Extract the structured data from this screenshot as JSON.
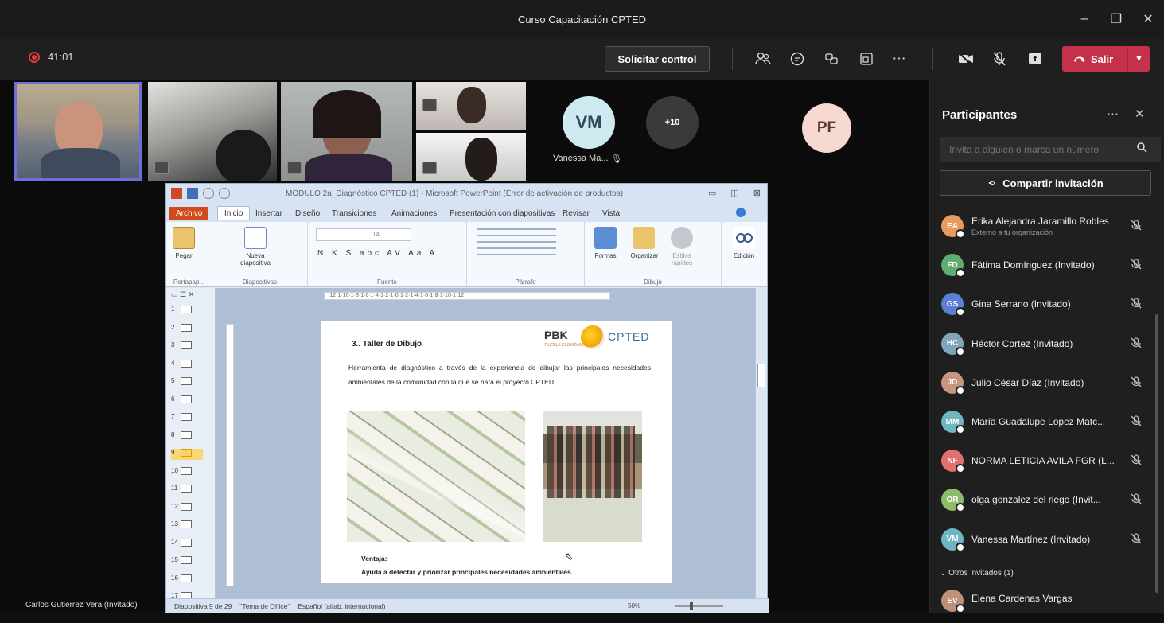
{
  "window": {
    "title": "Curso Capacitación CPTED",
    "minimize": "–",
    "maximize": "❐",
    "close": "✕"
  },
  "callbar": {
    "timer": "41:01",
    "request_control": "Solicitar control",
    "leave_label": "Salir",
    "icons": [
      "participants-icon",
      "chat-icon",
      "reactions-icon",
      "rooms-icon",
      "more-icon",
      "camera-off-icon",
      "mic-off-icon",
      "share-icon"
    ]
  },
  "stage": {
    "tiles": [
      {
        "initials": "VM",
        "name": "Vanessa Ma...",
        "color": "#cfe9f0"
      },
      {
        "initials": "+10",
        "color": "#3a3a3a"
      },
      {
        "initials": "PF",
        "color": "#f6d9d0"
      }
    ],
    "presenter_name": "Carlos Gutierrez Vera (Invitado)"
  },
  "ppt": {
    "doc_title": "MÓDULO 2a_Diagnóstico CPTED (1) - Microsoft PowerPoint (Error de activación de productos)",
    "tabs": [
      "Archivo",
      "Inicio",
      "Insertar",
      "Diseño",
      "Transiciones",
      "Animaciones",
      "Presentación con diapositivas",
      "Revisar",
      "Vista"
    ],
    "groups": {
      "clipboard": "Portapap...",
      "paste": "Pegar",
      "slides": "Diapositivas",
      "new_slide": "Nueva diapositiva",
      "font": "Fuente",
      "font_size": "14",
      "format_row": "N K S abc AV Aa A",
      "paragraph": "Párrafo",
      "drawing": "Dibujo",
      "shapes": "Formas",
      "arrange": "Organizar",
      "quick_styles": "Estilos rápidos",
      "editing": "Edición"
    },
    "ruler": "·12·1·10·1·8·1·6·1·4·1·2·1·0·1·2·1·4·1·6·1·8·1·10·1·12",
    "slide_numbers": [
      "1",
      "2",
      "3",
      "4",
      "5",
      "6",
      "7",
      "8",
      "9",
      "10",
      "11",
      "12",
      "13",
      "14",
      "15",
      "16",
      "17"
    ],
    "slide": {
      "title": "3.. Taller de Dibujo",
      "body": "Herramienta de diagnóstico a través de la experiencia de dibujar las principales necesidades ambientales de la comunidad con la que se hará el proyecto CPTED.",
      "logo_pbk": "PBK",
      "logo_pbk_sub": "PUEBLA CIUDADANA",
      "logo_cpted": "CPTED",
      "ventaja_label": "Ventaja:",
      "ventaja_text": "Ayuda a detectar y priorizar principales necesidades ambientales."
    },
    "status": {
      "slide_info": "Diapositiva 9 de 29",
      "theme": "\"Tema de Office\"",
      "language": "Español (alfab. internacional)",
      "zoom": "50%"
    }
  },
  "panel": {
    "title": "Participantes",
    "invite_placeholder": "Invita a alguien o marca un número",
    "share_label": "Compartir invitación",
    "participants": [
      {
        "initials": "EA",
        "name": "Erika Alejandra Jaramillo Robles",
        "sub": "Externo a tu organización",
        "color": "#e89b5e"
      },
      {
        "initials": "FD",
        "name": "Fátima Domínguez (Invitado)",
        "color": "#5fae6f"
      },
      {
        "initials": "GS",
        "name": "Gina Serrano (Invitado)",
        "color": "#5b7fd6"
      },
      {
        "initials": "HC",
        "name": "Héctor Cortez (Invitado)",
        "color": "#7fa6b8"
      },
      {
        "initials": "JD",
        "name": "Julio César Díaz (Invitado)",
        "color": "#c79580"
      },
      {
        "initials": "MM",
        "name": "María Guadalupe Lopez Matc...",
        "color": "#6fb6c2"
      },
      {
        "initials": "NF",
        "name": "NORMA LETICIA AVILA FGR (L...",
        "color": "#e07070"
      },
      {
        "initials": "OR",
        "name": "olga gonzalez del riego (Invit...",
        "color": "#8dbb6a"
      },
      {
        "initials": "VM",
        "name": "Vanessa Martínez (Invitado)",
        "color": "#6fb6c2"
      }
    ],
    "others_label": "Otros invitados (1)",
    "other_guest": {
      "initials": "EV",
      "name": "Elena Cardenas Vargas",
      "color": "#c0907a"
    }
  }
}
